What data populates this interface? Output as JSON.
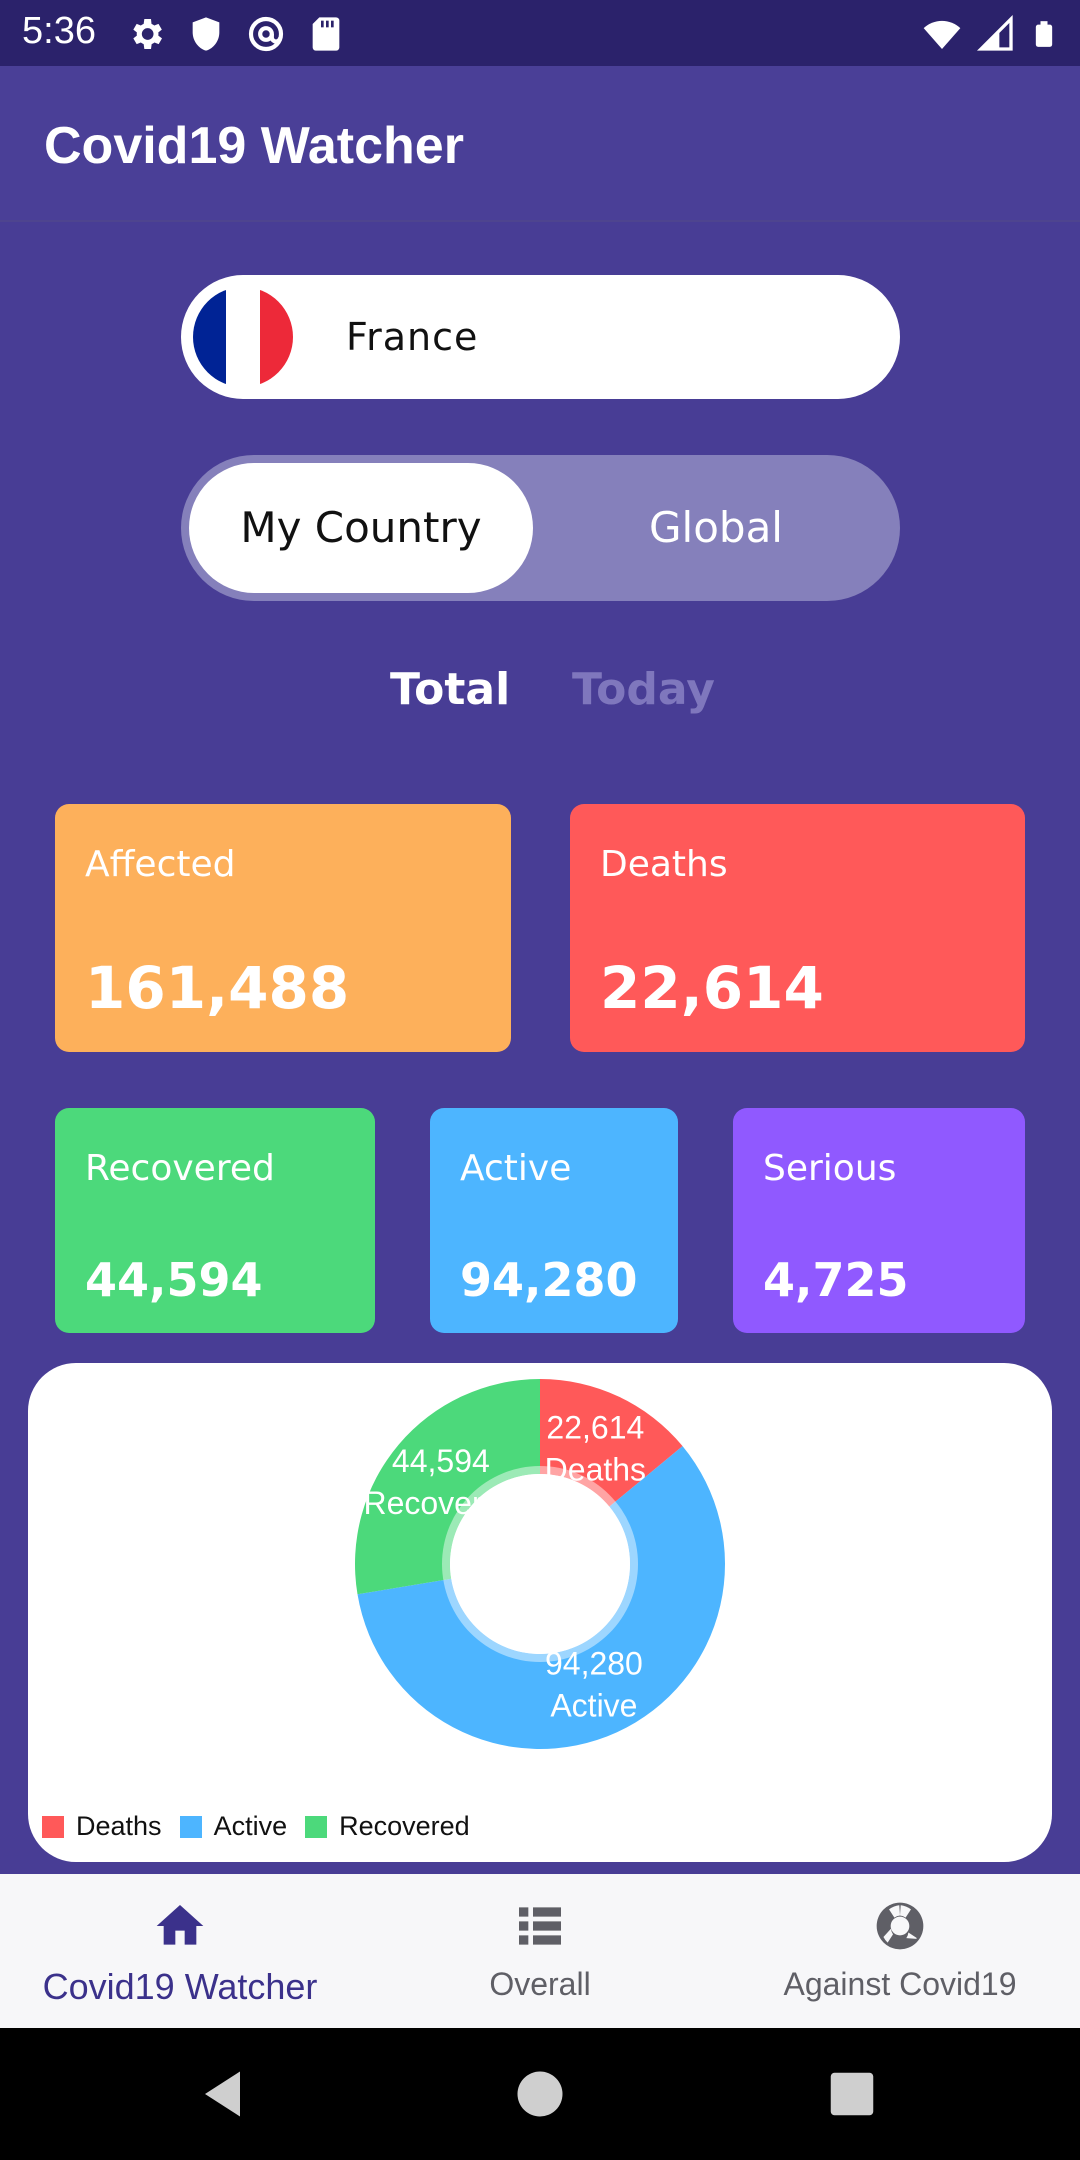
{
  "status_bar": {
    "time": "5:36",
    "left_icons": [
      "gear-icon",
      "shield-icon",
      "at-sign-icon",
      "sd-card-icon"
    ],
    "right_icons": [
      "wifi-icon",
      "signal-icon",
      "battery-icon"
    ]
  },
  "app_bar": {
    "title": "Covid19 Watcher"
  },
  "country_selector": {
    "country": "France",
    "flag_colors": [
      "#002395",
      "#ffffff",
      "#ed2939"
    ]
  },
  "scope_toggle": {
    "options": [
      "My Country",
      "Global"
    ],
    "selected": "My Country"
  },
  "period_tabs": {
    "total": "Total",
    "today": "Today",
    "selected": "Total"
  },
  "stats": {
    "affected": {
      "label": "Affected",
      "value": "161,488",
      "color": "#fdb05b"
    },
    "deaths": {
      "label": "Deaths",
      "value": "22,614",
      "color": "#ff5959"
    },
    "recovered": {
      "label": "Recovered",
      "value": "44,594",
      "color": "#4cd97b"
    },
    "active": {
      "label": "Active",
      "value": "94,280",
      "color": "#4db5ff"
    },
    "serious": {
      "label": "Serious",
      "value": "4,725",
      "color": "#9059ff"
    }
  },
  "chart_data": {
    "type": "pie",
    "categories": [
      "Deaths",
      "Active",
      "Recovered"
    ],
    "values": [
      22614,
      94280,
      44594
    ],
    "slice_labels": [
      {
        "value": "22,614",
        "name": "Deaths"
      },
      {
        "value": "94,280",
        "name": "Active"
      },
      {
        "value": "44,594",
        "name": "Recovered"
      }
    ],
    "colors": [
      "#ff5959",
      "#4db5ff",
      "#4cd97b"
    ],
    "legend": [
      "Deaths",
      "Active",
      "Recovered"
    ],
    "legend_position": "bottom-left"
  },
  "bottom_nav": {
    "items": [
      {
        "label": "Covid19 Watcher",
        "icon": "home-icon",
        "active": true
      },
      {
        "label": "Overall",
        "icon": "list-icon",
        "active": false
      },
      {
        "label": "Against Covid19",
        "icon": "lifebuoy-icon",
        "active": false
      }
    ]
  },
  "system_nav": {
    "icons": [
      "back-icon",
      "home-circle-icon",
      "recents-icon"
    ]
  }
}
